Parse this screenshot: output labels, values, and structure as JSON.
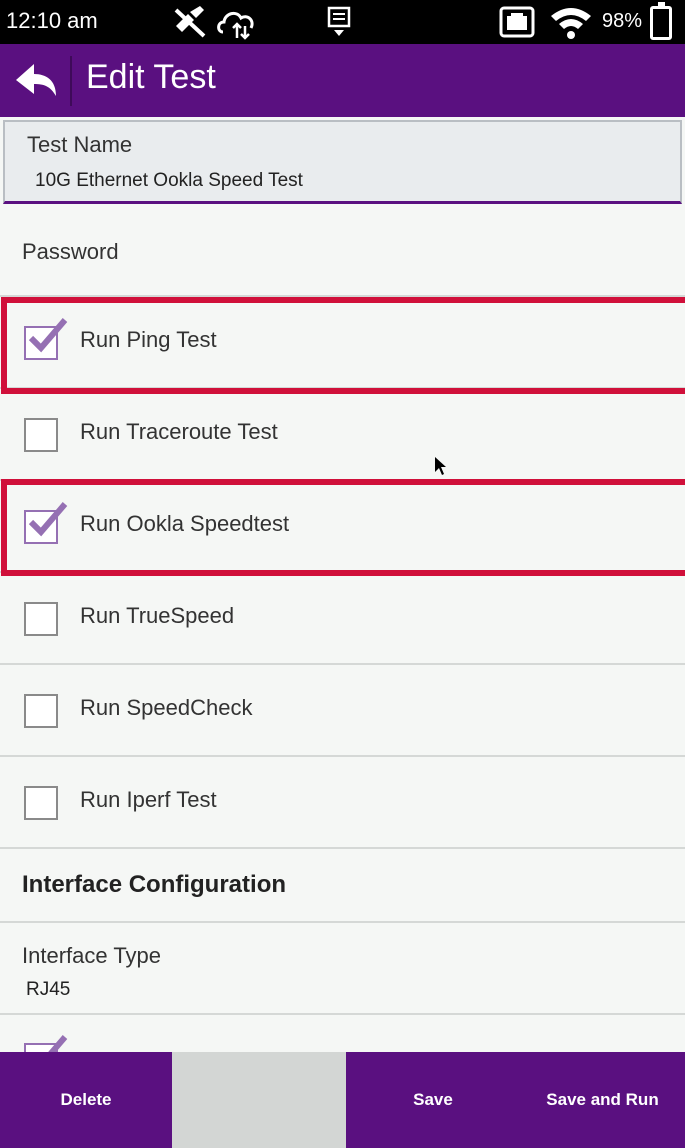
{
  "status_bar": {
    "time": "12:10 am",
    "battery": "98%",
    "icons": [
      "gps-off-icon",
      "cloud-sync-icon",
      "notification-icon",
      "ethernet-icon",
      "wifi-icon",
      "battery-icon"
    ]
  },
  "app_bar": {
    "title": "Edit Test",
    "back_icon": "back-arrow-icon"
  },
  "form": {
    "test_name": {
      "label": "Test Name",
      "value": "10G Ethernet Ookla Speed Test"
    },
    "password": {
      "label": "Password"
    },
    "options": [
      {
        "label": "Run Ping Test",
        "checked": true,
        "highlighted": true
      },
      {
        "label": "Run Traceroute Test",
        "checked": false,
        "highlighted": false
      },
      {
        "label": "Run Ookla Speedtest",
        "checked": true,
        "highlighted": true
      },
      {
        "label": "Run TrueSpeed",
        "checked": false,
        "highlighted": false
      },
      {
        "label": "Run SpeedCheck",
        "checked": false,
        "highlighted": false
      },
      {
        "label": "Run Iperf Test",
        "checked": false,
        "highlighted": false
      }
    ],
    "interface_section": "Interface Configuration",
    "interface_type": {
      "label": "Interface Type",
      "value": "RJ45"
    },
    "partial_item": {
      "checked": true
    }
  },
  "bottom_bar": {
    "delete": "Delete",
    "save": "Save",
    "save_and_run": "Save and Run"
  },
  "colors": {
    "primary": "#5a1080",
    "highlight": "#d0103a",
    "check": "#9570b3",
    "background": "#f5f7f5"
  }
}
